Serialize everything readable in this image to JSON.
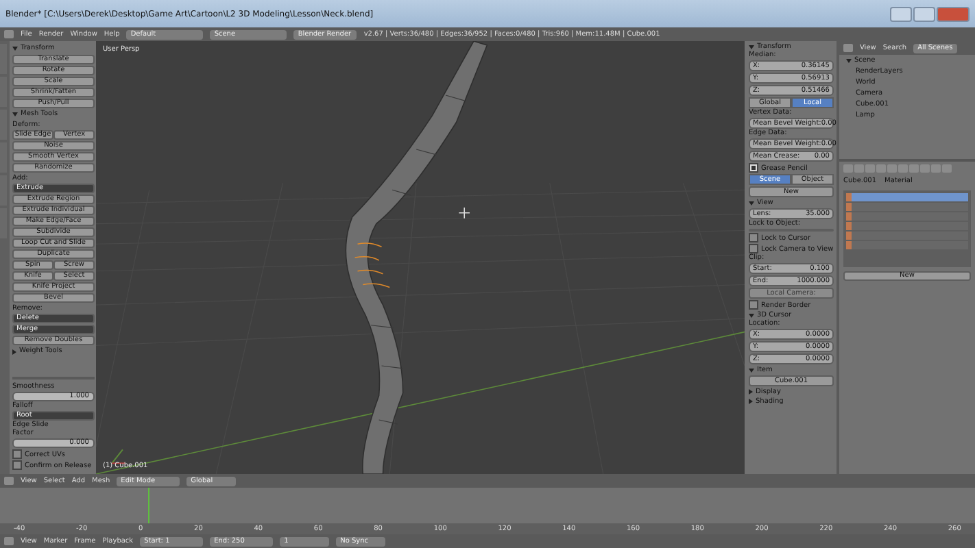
{
  "window": {
    "title": "Blender* [C:\\Users\\Derek\\Desktop\\Game Art\\Cartoon\\L2 3D Modeling\\Lesson\\Neck.blend]"
  },
  "top_bar": {
    "menus": [
      "File",
      "Render",
      "Window",
      "Help"
    ],
    "layout": "Default",
    "scene": "Scene",
    "engine": "Blender Render",
    "stats": "v2.67 | Verts:36/480 | Edges:36/952 | Faces:0/480 | Tris:960 | Mem:11.48M | Cube.001"
  },
  "tool_shelf": {
    "rows": [
      {
        "kind": "header",
        "label": "Transform",
        "expanded": true
      },
      {
        "kind": "button",
        "labels": [
          "Translate"
        ]
      },
      {
        "kind": "button",
        "labels": [
          "Rotate"
        ]
      },
      {
        "kind": "button",
        "labels": [
          "Scale"
        ]
      },
      {
        "kind": "button",
        "labels": [
          "Shrink/Fatten"
        ]
      },
      {
        "kind": "button",
        "labels": [
          "Push/Pull"
        ]
      },
      {
        "kind": "header",
        "label": "Mesh Tools",
        "expanded": true
      },
      {
        "kind": "label",
        "label": "Deform:"
      },
      {
        "kind": "pair",
        "labels": [
          "Slide Edge",
          "Vertex"
        ]
      },
      {
        "kind": "button",
        "labels": [
          "Noise"
        ]
      },
      {
        "kind": "button",
        "labels": [
          "Smooth Vertex"
        ]
      },
      {
        "kind": "button",
        "labels": [
          "Randomize"
        ]
      },
      {
        "kind": "label",
        "label": "Add:"
      },
      {
        "kind": "dropdown",
        "labels": [
          "Extrude"
        ]
      },
      {
        "kind": "button",
        "labels": [
          "Extrude Region"
        ]
      },
      {
        "kind": "button",
        "labels": [
          "Extrude Individual"
        ]
      },
      {
        "kind": "button",
        "labels": [
          "Make Edge/Face"
        ]
      },
      {
        "kind": "button",
        "labels": [
          "Subdivide"
        ]
      },
      {
        "kind": "button",
        "labels": [
          "Loop Cut and Slide"
        ]
      },
      {
        "kind": "button",
        "labels": [
          "Duplicate"
        ]
      },
      {
        "kind": "pair",
        "labels": [
          "Spin",
          "Screw"
        ]
      },
      {
        "kind": "pair",
        "labels": [
          "Knife",
          "Select"
        ]
      },
      {
        "kind": "button",
        "labels": [
          "Knife Project"
        ]
      },
      {
        "kind": "button",
        "labels": [
          "Bevel"
        ]
      },
      {
        "kind": "label",
        "label": "Remove:"
      },
      {
        "kind": "dropdown",
        "labels": [
          "Delete"
        ]
      },
      {
        "kind": "dropdown",
        "labels": [
          "Merge"
        ]
      },
      {
        "kind": "button",
        "labels": [
          "Remove Doubles"
        ]
      },
      {
        "kind": "header",
        "label": "Weight Tools",
        "expanded": false
      }
    ]
  },
  "operator_panel": {
    "rows": [
      {
        "kind": "label",
        "label": "Smoothness"
      },
      {
        "kind": "slider",
        "value": "1.000"
      },
      {
        "kind": "label",
        "label": "Falloff"
      },
      {
        "kind": "dropdown",
        "labels": [
          "Root"
        ]
      },
      {
        "kind": "label",
        "label": "Edge Slide"
      },
      {
        "kind": "label",
        "label": "Factor"
      },
      {
        "kind": "slider",
        "value": "0.000"
      },
      {
        "kind": "check",
        "label": "Correct UVs",
        "checked": false
      },
      {
        "kind": "check",
        "label": "Confirm on Release",
        "checked": false
      }
    ]
  },
  "viewport": {
    "view_name": "User Persp",
    "object_name": "(1) Cube.001"
  },
  "properties_panel": {
    "rows": [
      {
        "kind": "header",
        "label": "Transform",
        "expanded": true
      },
      {
        "kind": "label",
        "label": "Median:"
      },
      {
        "kind": "field",
        "label": "X:",
        "value": "0.36145"
      },
      {
        "kind": "field",
        "label": "Y:",
        "value": "0.56913"
      },
      {
        "kind": "field",
        "label": "Z:",
        "value": "0.51466"
      },
      {
        "kind": "toggle",
        "options": [
          {
            "label": "Global",
            "selected": false
          },
          {
            "label": "Local",
            "selected": true
          }
        ]
      },
      {
        "kind": "label",
        "label": "Vertex Data:"
      },
      {
        "kind": "field",
        "label": "Mean Bevel Weight:",
        "value": "0.00"
      },
      {
        "kind": "label",
        "label": "Edge Data:"
      },
      {
        "kind": "field",
        "label": "Mean Bevel Weight:",
        "value": "0.00"
      },
      {
        "kind": "field",
        "label": "Mean Crease:",
        "value": "0.00"
      },
      {
        "kind": "check",
        "label": "Grease Pencil",
        "checked": true
      },
      {
        "kind": "toggle",
        "options": [
          {
            "label": "Scene",
            "selected": true
          },
          {
            "label": "Object",
            "selected": false
          }
        ]
      },
      {
        "kind": "button",
        "label": "New"
      },
      {
        "kind": "header",
        "label": "View",
        "expanded": true
      },
      {
        "kind": "field",
        "label": "Lens:",
        "value": "35.000"
      },
      {
        "kind": "label",
        "label": "Lock to Object:"
      },
      {
        "kind": "button",
        "label": ""
      },
      {
        "kind": "check",
        "label": "Lock to Cursor",
        "checked": false
      },
      {
        "kind": "check",
        "label": "Lock Camera to View",
        "checked": false
      },
      {
        "kind": "label",
        "label": "Clip:"
      },
      {
        "kind": "field",
        "label": "Start:",
        "value": "0.100"
      },
      {
        "kind": "field",
        "label": "End:",
        "value": "1000.000"
      },
      {
        "kind": "button",
        "label": "Local Camera:",
        "disabled": true
      },
      {
        "kind": "check",
        "label": "Render Border",
        "checked": false
      },
      {
        "kind": "header",
        "label": "3D Cursor",
        "expanded": true
      },
      {
        "kind": "label",
        "label": "Location:"
      },
      {
        "kind": "field",
        "label": "X:",
        "value": "0.0000"
      },
      {
        "kind": "field",
        "label": "Y:",
        "value": "0.0000"
      },
      {
        "kind": "field",
        "label": "Z:",
        "value": "0.0000"
      },
      {
        "kind": "header",
        "label": "Item",
        "expanded": true
      },
      {
        "kind": "button",
        "label": "Cube.001"
      },
      {
        "kind": "header",
        "label": "Display",
        "expanded": false
      },
      {
        "kind": "header",
        "label": "Shading",
        "expanded": false
      }
    ]
  },
  "outliner": {
    "menus": [
      "View",
      "Search"
    ],
    "filter": "All Scenes",
    "tree": [
      {
        "label": "Scene",
        "expanded": true,
        "children": [
          {
            "label": "RenderLayers"
          },
          {
            "label": "World"
          },
          {
            "label": "Camera"
          },
          {
            "label": "Cube.001"
          },
          {
            "label": "Lamp"
          }
        ]
      }
    ]
  },
  "properties_editor": {
    "path": [
      "Cube.001",
      "Material"
    ],
    "slots": [
      {
        "selected": true
      },
      {
        "selected": false
      },
      {
        "selected": false
      },
      {
        "selected": false
      },
      {
        "selected": false
      },
      {
        "selected": false
      }
    ],
    "new_button": "New"
  },
  "view3d_header": {
    "menus": [
      "View",
      "Select",
      "Add",
      "Mesh"
    ],
    "mode": "Edit Mode",
    "orientation": "Global"
  },
  "timeline": {
    "ticks": [
      "-40",
      "-20",
      "0",
      "20",
      "40",
      "60",
      "80",
      "100",
      "120",
      "140",
      "160",
      "180",
      "200",
      "220",
      "240",
      "260"
    ],
    "menus": [
      "View",
      "Marker",
      "Frame",
      "Playback"
    ],
    "start": "Start: 1",
    "end": "End: 250",
    "frame": "1",
    "sync": "No Sync"
  }
}
